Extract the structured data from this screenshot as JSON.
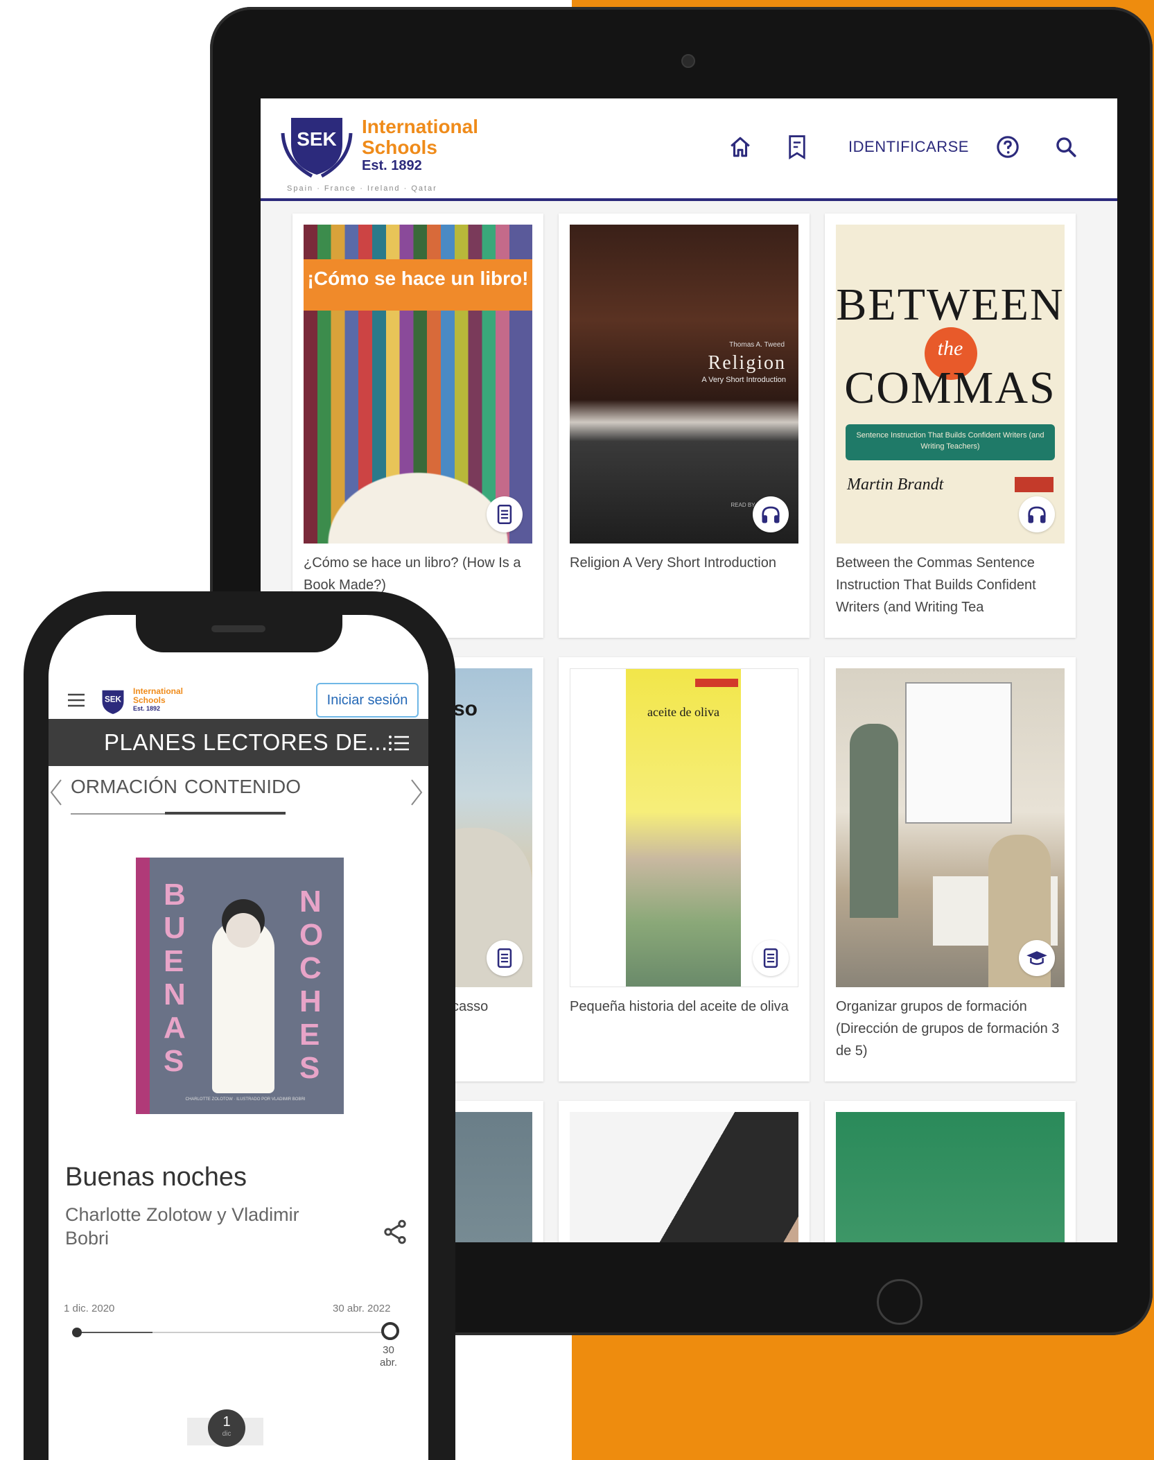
{
  "colors": {
    "orange": "#ee8c0e",
    "navy": "#2c2a7c",
    "dark_bar": "#3d3d3d"
  },
  "tablet": {
    "brand": {
      "line1": "International",
      "line2": "Schools",
      "est": "Est. 1892",
      "countries": "Spain · France · Ireland · Qatar",
      "logo_text": "SEK"
    },
    "nav": {
      "home_icon": "home-icon",
      "bookmarks_icon": "bookmark-list-icon",
      "login_label": "IDENTIFICARSE",
      "help_icon": "help-circle-icon",
      "search_icon": "search-icon"
    },
    "cards": [
      {
        "title": "¿Cómo se hace un libro? (How Is a Book Made?)",
        "cover_text": "¡Cómo se hace un libro!",
        "badge": "ebook-icon"
      },
      {
        "title": "Religion A Very Short Introduction",
        "cover_text": "Religion",
        "cover_sub": "A Very Short Introduction",
        "cover_author": "Thomas A. Tweed",
        "cover_footer": "READ BY AL KESSEL",
        "badge": "headphones-icon"
      },
      {
        "title": "Between the Commas Sentence Instruction That Builds Confident Writers (and Writing Tea",
        "cover_line1": "BETWEEN",
        "cover_the": "the",
        "cover_line2": "COMMAS",
        "cover_sub": "Sentence Instruction That Builds Confident Writers (and Writing Teachers)",
        "cover_author": "Martin Brandt",
        "badge": "headphones-icon"
      },
      {
        "title": "casso",
        "cover_text": "so",
        "badge": "ebook-icon"
      },
      {
        "title": "Pequeña historia del aceite de oliva",
        "cover_text": "aceite de oliva",
        "badge": "ebook-icon"
      },
      {
        "title": "Organizar grupos de formación (Dirección de grupos de formación 3 de 5)",
        "badge": "graduation-cap-icon"
      }
    ]
  },
  "phone": {
    "brand": {
      "line1": "International",
      "line2": "Schools",
      "est": "Est. 1892"
    },
    "login_button": "Iniciar sesión",
    "section_title": "PLANES LECTORES DE...",
    "tabs": [
      "ORMACIÓN",
      "CONTENIDO"
    ],
    "book": {
      "title": "Buenas noches",
      "author": "Charlotte Zolotow y Vladimir Bobri",
      "cover_left": "BUENAS",
      "cover_right": "NOCHES",
      "cover_footer": "CHARLOTTE ZOLOTOW · ILUSTRADO POR VLADIMIR BOBRI"
    },
    "timeline": {
      "start": "1 dic. 2020",
      "end": "30 abr. 2022",
      "end_day": "30",
      "end_month": "abr.",
      "page_number": "1",
      "page_sub": "dic"
    }
  }
}
